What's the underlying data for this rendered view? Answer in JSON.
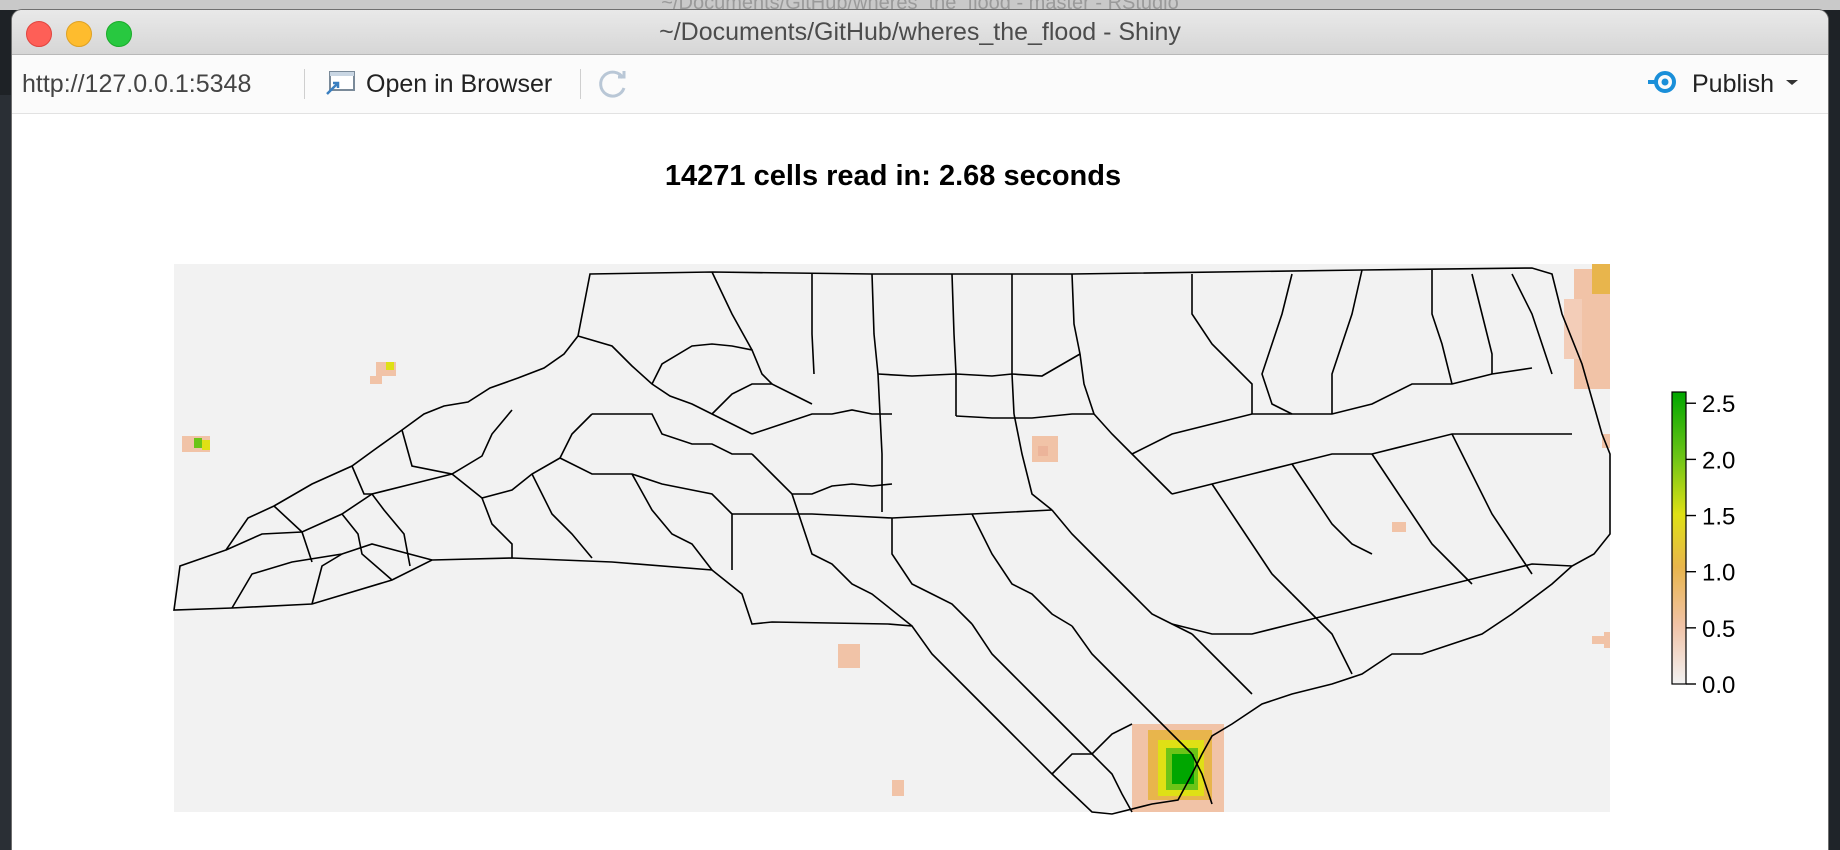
{
  "window": {
    "title": "~/Documents/GitHub/wheres_the_flood - Shiny",
    "background_title": "~/Documents/GitHub/wheres_the_flood - master - RStudio"
  },
  "toolbar": {
    "url": "http://127.0.0.1:5348",
    "open_in_browser_label": "Open in Browser",
    "publish_label": "Publish",
    "accent_color": "#1a8fd9"
  },
  "plot": {
    "title": "14271 cells read in: 2.68 seconds",
    "legend": {
      "ticks": [
        "2.5",
        "2.0",
        "1.5",
        "1.0",
        "0.5",
        "0.0"
      ],
      "min": 0.0,
      "max": 2.6,
      "colors": [
        "#f2f2f2",
        "#f1c3a7",
        "#e8b54c",
        "#dfe015",
        "#6cc417",
        "#00a600"
      ]
    }
  },
  "icons": {
    "open": "open-in-browser-icon",
    "refresh": "refresh-icon",
    "publish": "publish-icon",
    "dropdown": "chevron-down-icon"
  }
}
